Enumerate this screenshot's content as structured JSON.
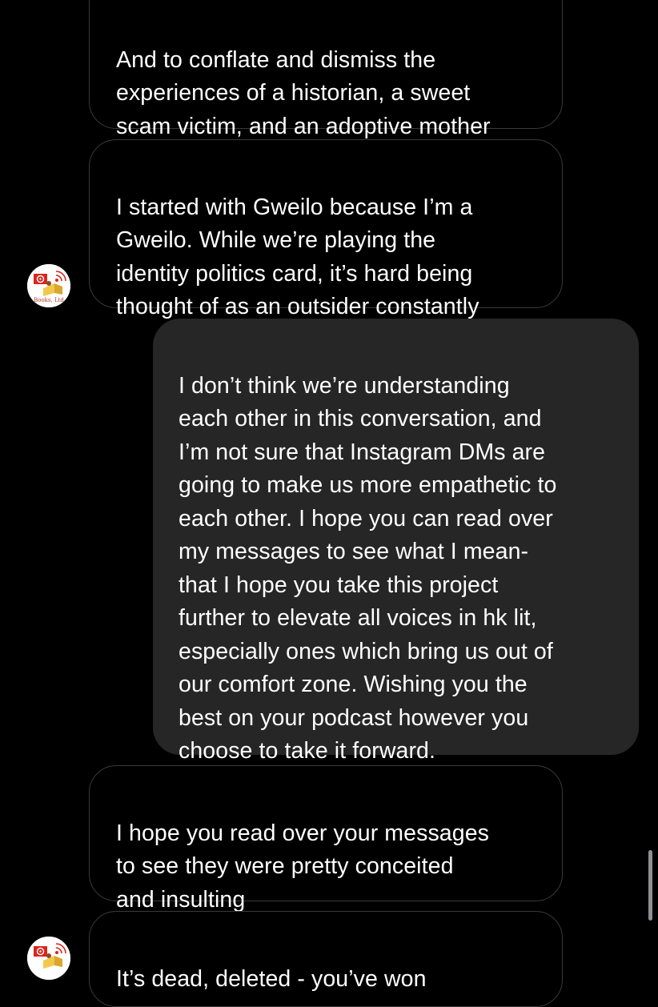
{
  "messages": [
    {
      "direction": "received",
      "text": "And to conflate and dismiss the\nexperiences of a historian, a sweet\nscam victim, and an adoptive mother"
    },
    {
      "direction": "received",
      "text": "I started with Gweilo because I’m a\nGweilo. While we’re playing the\nidentity politics card, it’s hard being\nthought of as an outsider constantly"
    },
    {
      "direction": "sent",
      "text": "I don’t think we’re understanding\neach other in this conversation, and\nI’m not sure that Instagram DMs are\ngoing to make us more empathetic to\neach other. I hope you can read over\nmy messages to see what I mean-\nthat I hope you take this project\nfurther to elevate all voices in hk lit,\nespecially ones which bring us out of\nour comfort zone. Wishing you the\nbest on your podcast however you\nchoose to take it forward."
    },
    {
      "direction": "received",
      "text": "I hope you read over your messages\nto see they were pretty conceited\nand insulting"
    },
    {
      "direction": "received",
      "text": "It’s dead, deleted - you’ve won"
    }
  ],
  "contact": {
    "avatar_icon": "books-ltd-logo-icon",
    "avatar_label": "Books, Ltd"
  },
  "colors": {
    "background": "#000000",
    "sent_bubble": "#262626",
    "received_border": "#3a3a3c",
    "text": "#ffffff",
    "logo_red": "#d8261c",
    "logo_gold": "#f2c84b"
  }
}
